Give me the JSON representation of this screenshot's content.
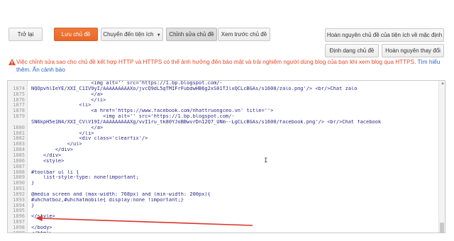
{
  "toolbar": {
    "back": "Trở lại",
    "save": "Lưu chủ đề",
    "switch_widgets": "Chuyển đến tiện ích",
    "edit_theme": "Chỉnh sửa chủ đề",
    "preview": "Xem trước chủ đề",
    "restore_widget_defaults": "Hoàn nguyên chủ đề của tiện ích về mặc định",
    "format_theme": "Định dạng chủ đề",
    "revert_changes": "Hoàn nguyên thay đổi"
  },
  "warning": {
    "text": "Việc chỉnh sửa sao cho chủ đề kết hợp HTTP và HTTPS có thể ảnh hưởng đến bảo mật và trải nghiệm người dùng blog của bạn khi xem blog qua HTTPS.",
    "link": "Tìm hiểu thêm.",
    "dismiss": "Ẩn cảnh báo"
  },
  "colors": {
    "accent": "#e8692a",
    "warning": "#e54b2a",
    "link": "#2a65c7",
    "arrow": "#d9362b"
  },
  "editor": {
    "lines": [
      {
        "n": "",
        "t": "                    <img alt='' src='https://1.bp.blogspot.com/-"
      },
      {
        "n": "1874",
        "t": "NQOpvhlIeYE/XXI_C1IV9yI/AAAAAAAAAXo/jvcQ9dL5qTMIFrFubdwHB6g2xS01TJlxQCLcBGAs/s1600/zalo.png'/> <br/>Chat zalo"
      },
      {
        "n": "1875",
        "t": "                    </a>"
      },
      {
        "n": "1876",
        "t": "                    </li>"
      },
      {
        "n": "1877",
        "t": "                <li>"
      },
      {
        "n": "1878",
        "t": "                    <a href='https://www.facebook.com/nhattruongceo.vn' title=''>"
      },
      {
        "n": "1879",
        "t": "                        <img alt='' src='https://1.bp.blogspot.com/-"
      },
      {
        "n": "",
        "t": "SN6kpH5e1N4/XXI_CVlV19I/AAAAAAAAAXg/vvI1ru_tk80YJoBBwvrDn12Q7_UNm--LgCLcBGAs/s1600/facebook.png'/> <br/>Chat facebook"
      },
      {
        "n": "1880",
        "t": "                    </a>"
      },
      {
        "n": "1881",
        "t": "                </li>"
      },
      {
        "n": "1882",
        "t": "                <div class='clearfix'/>"
      },
      {
        "n": "1883",
        "t": "            </ul>"
      },
      {
        "n": "1884",
        "t": "        </div>"
      },
      {
        "n": "1885",
        "t": "    </div>"
      },
      {
        "n": "1886",
        "t": "    <style>"
      },
      {
        "n": "1887",
        "t": ""
      },
      {
        "n": "1888",
        "t": "#toolbar ul li {"
      },
      {
        "n": "1889",
        "t": "    list-style-type: none!important;"
      },
      {
        "n": "1890",
        "t": "}"
      },
      {
        "n": "1891",
        "t": ""
      },
      {
        "n": "1892",
        "t": "@media screen and (max-width: 768px) and (min-width: 200px){"
      },
      {
        "n": "1893",
        "t": "#uhchatboz,#uhchatmobile{ display:none !important;}"
      },
      {
        "n": "1894",
        "t": "}"
      },
      {
        "n": "1895",
        "t": ""
      },
      {
        "n": "1896",
        "t": "</style>"
      },
      {
        "n": "1897",
        "t": ""
      },
      {
        "n": "1898",
        "t": "</body>"
      },
      {
        "n": "1899",
        "t": "</html>"
      }
    ]
  },
  "icons": {
    "warning": "warning-triangle-icon",
    "scroll_up": "scroll-up-icon"
  }
}
